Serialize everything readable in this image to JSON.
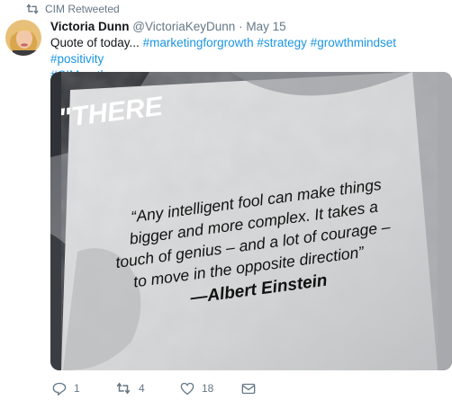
{
  "retweet_bar": {
    "label": "CIM Retweeted",
    "icon": "retweet-icon"
  },
  "tweet": {
    "author_name": "Victoria Dunn",
    "author_handle": "@VictoriaKeyDunn",
    "separator": "·",
    "date": "May 15",
    "text_plain": "Quote of today...",
    "hashtags": [
      "#marketingforgrowth",
      "#strategy",
      "#growthmindset",
      "#positivity",
      "#CIMnortherncon"
    ]
  },
  "image": {
    "corner_text": "\"THERE",
    "quote_lines": [
      "“Any intelligent fool can make things",
      "bigger and more complex. It takes a",
      "touch of genius – and a lot of courage –",
      "to move in the opposite direction”",
      "—Albert Einstein"
    ]
  },
  "actions": {
    "reply_count": "1",
    "retweet_count": "4",
    "like_count": "18",
    "icons": [
      "reply-icon",
      "retweet-icon",
      "heart-icon",
      "envelope-icon"
    ]
  },
  "colors": {
    "link": "#1b95e0",
    "muted": "#657786",
    "text": "#14171a"
  }
}
